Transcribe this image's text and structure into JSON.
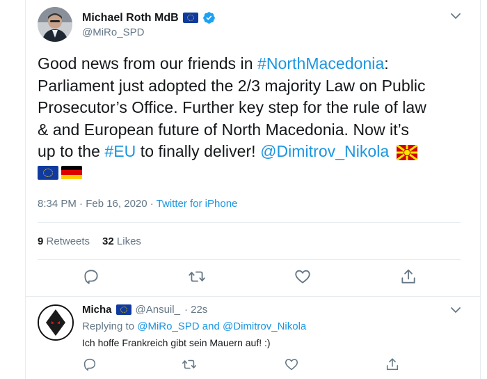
{
  "tweet": {
    "author_name": "Michael Roth MdB",
    "author_handle": "@MiRo_SPD",
    "text_lines": [
      [
        "Good news from our friends in ",
        "#NorthMacedonia",
        ":"
      ],
      [
        "Parliament just adopted the 2/3 majority Law on Public"
      ],
      [
        "Prosecutor’s Office. Further key step for the rule of law"
      ],
      [
        "& and European future of North Macedonia. Now it’s"
      ],
      [
        "up to the ",
        "#EU",
        " to finally deliver! ",
        "@Dimitrov_Nikola"
      ]
    ],
    "t1": "Good news from our friends in ",
    "t1_link": "#NorthMacedonia",
    "t1_end": ":",
    "t2": "Parliament just adopted the 2/3 majority Law on Public",
    "t3": "Prosecutor’s Office. Further key step for the rule of law",
    "t4": "& and European future of North Macedonia. Now it’s",
    "t5a": "up to the ",
    "t5_link1": "#EU",
    "t5b": " to finally deliver! ",
    "t5_link2": "@Dimitrov_Nikola",
    "time": "8:34 PM · Feb 16, 2020 · ",
    "source": "Twitter for iPhone",
    "retweets_count": "9",
    "retweets_label": "Retweets",
    "likes_count": "32",
    "likes_label": "Likes"
  },
  "reply": {
    "author_name": "Micha",
    "author_handle": "@Ansuil_",
    "age": "· 22s",
    "replying_prefix": "Replying to ",
    "replying_user1": "@MiRo_SPD",
    "replying_and": " and ",
    "replying_user2": "@Dimitrov_Nikola",
    "text": "Ich hoffe Frankreich gibt sein Mauern auf! :)"
  },
  "icons": {
    "verified": "verified-badge-icon",
    "reply": "reply-icon",
    "retweet": "retweet-icon",
    "like": "heart-icon",
    "share": "share-icon",
    "caret": "chevron-down-icon"
  },
  "colors": {
    "link": "#1b95e0",
    "muted": "#657786",
    "text": "#14171a",
    "divider": "#e6ecf0"
  }
}
